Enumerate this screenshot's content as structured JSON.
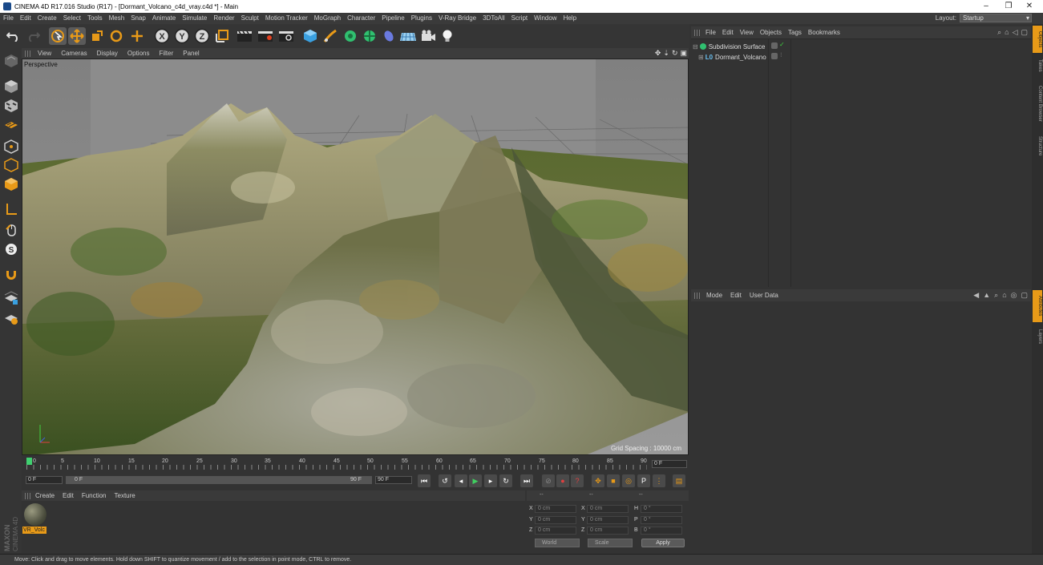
{
  "window": {
    "title": "CINEMA 4D R17.016 Studio (R17) - [Dormant_Volcano_c4d_vray.c4d *] - Main",
    "minimize": "–",
    "restore": "❐",
    "close": "✕"
  },
  "menu": [
    "File",
    "Edit",
    "Create",
    "Select",
    "Tools",
    "Mesh",
    "Snap",
    "Animate",
    "Simulate",
    "Render",
    "Sculpt",
    "Motion Tracker",
    "MoGraph",
    "Character",
    "Pipeline",
    "Plugins",
    "V-Ray Bridge",
    "3DToAll",
    "Script",
    "Window",
    "Help"
  ],
  "layout": {
    "label": "Layout:",
    "value": "Startup"
  },
  "viewport": {
    "menu": [
      "View",
      "Cameras",
      "Display",
      "Options",
      "Filter",
      "Panel"
    ],
    "camera_label": "Perspective",
    "grid_spacing": "Grid Spacing : 10000 cm"
  },
  "timeline": {
    "ticks": [
      "0",
      "5",
      "10",
      "15",
      "20",
      "25",
      "30",
      "35",
      "40",
      "45",
      "50",
      "55",
      "60",
      "65",
      "70",
      "75",
      "80",
      "85",
      "90"
    ],
    "current_frame": "0 F",
    "start_field": "0 F",
    "range_start": "0 F",
    "range_end": "90 F",
    "end_field": "90 F"
  },
  "material_manager": {
    "menu": [
      "Create",
      "Edit",
      "Function",
      "Texture"
    ],
    "material_name": "VR_Volc"
  },
  "logo": {
    "maxon": "MAXON",
    "product": "CINEMA 4D"
  },
  "coordinates": {
    "header": [
      "--",
      "--",
      "--"
    ],
    "rows": [
      {
        "a": "X",
        "av": "0 cm",
        "b": "X",
        "bv": "0 cm",
        "c": "H",
        "cv": "0 °"
      },
      {
        "a": "Y",
        "av": "0 cm",
        "b": "Y",
        "bv": "0 cm",
        "c": "P",
        "cv": "0 °"
      },
      {
        "a": "Z",
        "av": "0 cm",
        "b": "Z",
        "bv": "0 cm",
        "c": "B",
        "cv": "0 °"
      }
    ],
    "world": "World",
    "scale": "Scale",
    "apply": "Apply"
  },
  "objects_panel": {
    "menu": [
      "File",
      "Edit",
      "View",
      "Objects",
      "Tags",
      "Bookmarks"
    ],
    "items": [
      {
        "name": "Subdivision Surface"
      },
      {
        "name": "Dormant_Volcano"
      }
    ]
  },
  "attributes_panel": {
    "menu": [
      "Mode",
      "Edit",
      "User Data"
    ]
  },
  "side_tabs": [
    "Objects",
    "Takes",
    "Content Browser",
    "Structure",
    "Attributes",
    "Layers"
  ],
  "status": "Move: Click and drag to move elements. Hold down SHIFT to quantize movement / add to the selection in point mode, CTRL to remove.",
  "colors": {
    "accent": "#e89a18",
    "panel": "#333333",
    "viewport_sky": "#8a8a8a"
  }
}
